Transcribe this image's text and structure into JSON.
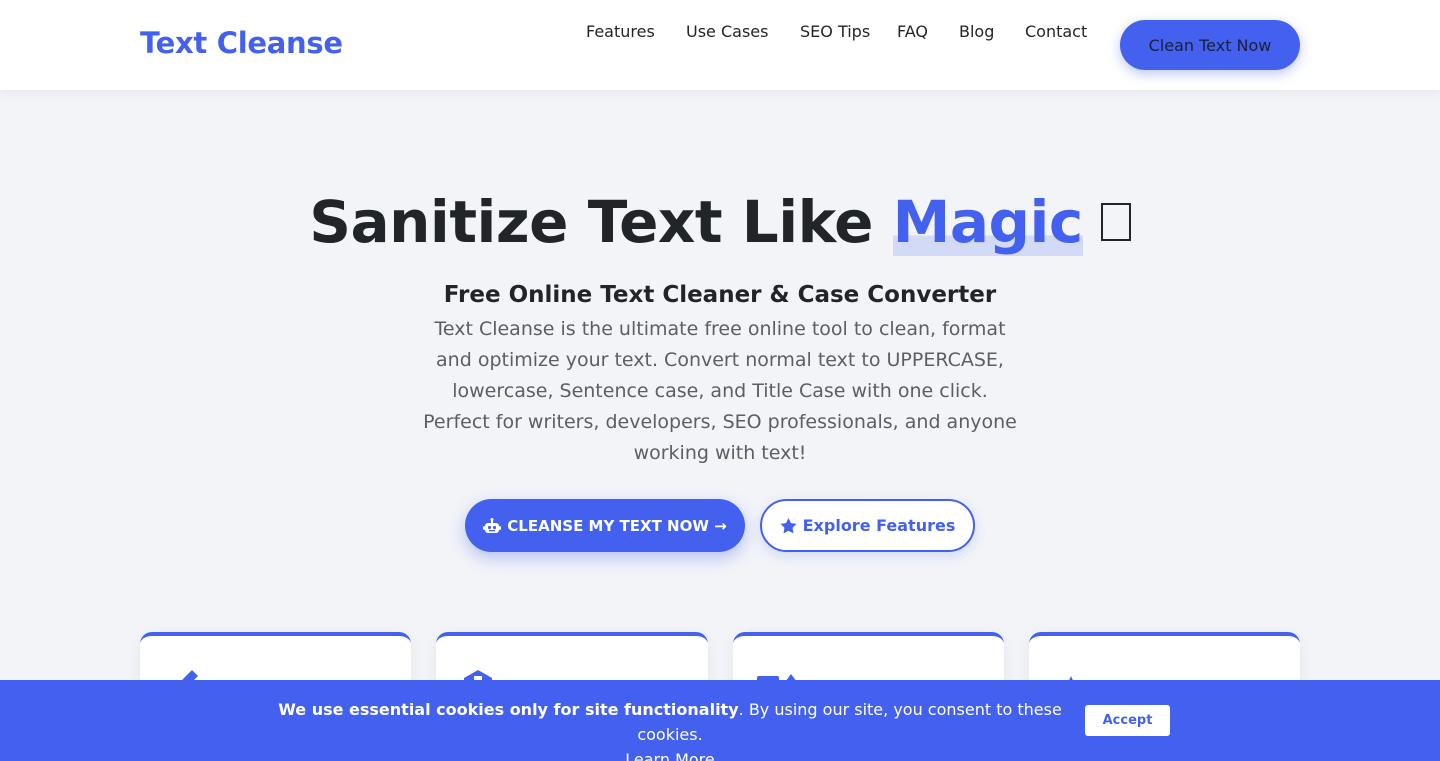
{
  "header": {
    "logo": "Text Cleanse",
    "nav": [
      "Features",
      "Use Cases",
      "SEO Tips",
      "FAQ",
      "Blog",
      "Contact"
    ],
    "cta_label": "Clean Text Now"
  },
  "hero": {
    "title_main": "Sanitize Text Like ",
    "title_accent": "Magic",
    "subtitle": "Free Online Text Cleaner & Case Converter",
    "description": "Text Cleanse is the ultimate free online tool to clean, format and optimize your text. Convert normal text to UPPERCASE, lowercase, Sentence case, and Title Case with one click. Perfect for writers, developers, SEO professionals, and anyone working with text!",
    "primary_button": "CLEANSE MY TEXT NOW →",
    "primary_button_icon": "robot-icon",
    "secondary_button": "Explore Features",
    "secondary_button_icon": "star-icon"
  },
  "cards": [
    {
      "icon": "pen-icon"
    },
    {
      "icon": "tag-icon"
    },
    {
      "icon": "chart-icon"
    },
    {
      "icon": "flask-icon"
    }
  ],
  "cookie_banner": {
    "bold_text": "We use essential cookies only for site functionality",
    "text": ". By using our site, you consent to these cookies.",
    "learn_more": "Learn More",
    "accept": "Accept"
  },
  "colors": {
    "accent": "#4361ee",
    "text": "#212529",
    "muted": "#5a5f66",
    "background": "#f2f4f8"
  }
}
